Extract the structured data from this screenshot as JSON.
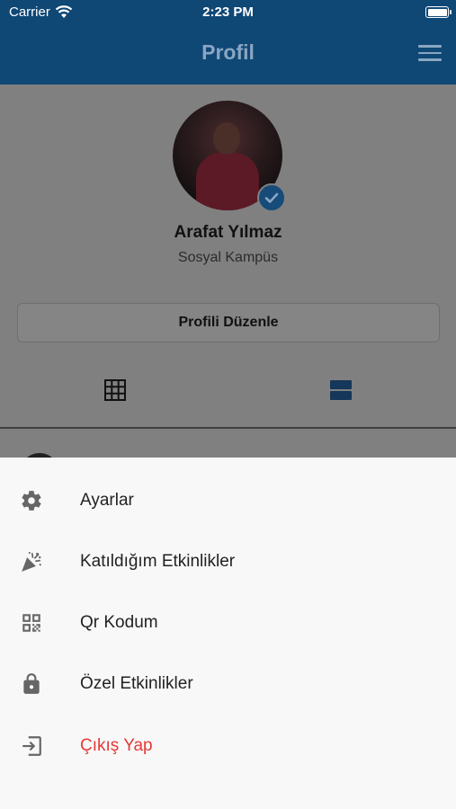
{
  "status_bar": {
    "carrier": "Carrier",
    "time": "2:23 PM"
  },
  "nav": {
    "title": "Profil"
  },
  "profile": {
    "name": "Arafat Yılmaz",
    "subtitle": "Sosyal Kampüs",
    "edit_button": "Profili Düzenle"
  },
  "menu": {
    "items": [
      {
        "label": "Ayarlar",
        "icon": "gear-icon"
      },
      {
        "label": "Katıldığım Etkinlikler",
        "icon": "party-popper-icon"
      },
      {
        "label": "Qr Kodum",
        "icon": "qr-code-icon"
      },
      {
        "label": "Özel Etkinlikler",
        "icon": "lock-icon"
      },
      {
        "label": "Çıkış Yap",
        "icon": "logout-icon"
      }
    ]
  },
  "colors": {
    "nav_bar": "#0f4775",
    "accent": "#1565c0",
    "logout": "#e53935",
    "sheet_bg": "#f8f8f8"
  }
}
